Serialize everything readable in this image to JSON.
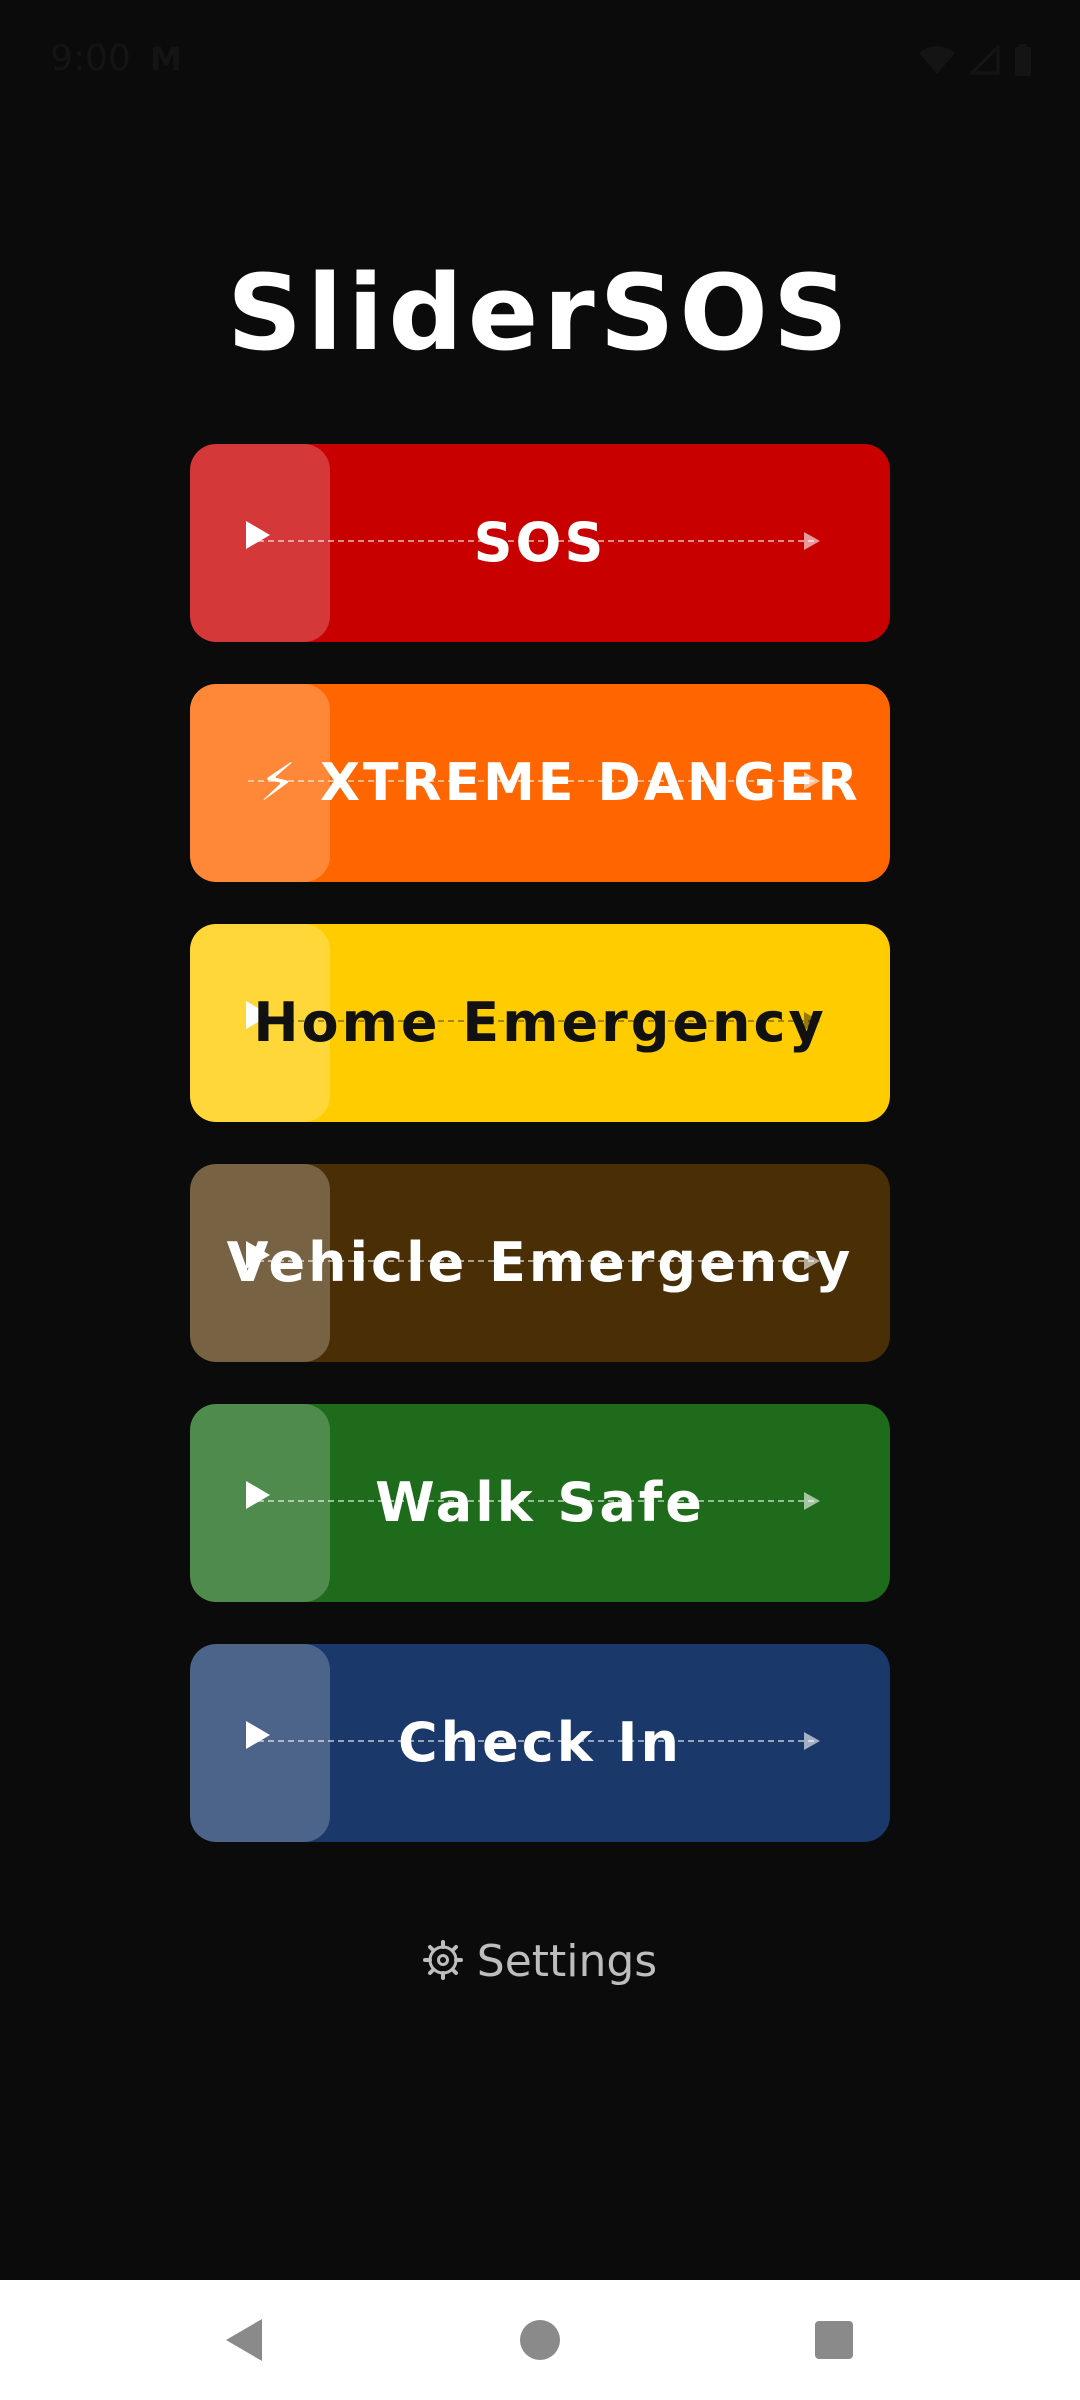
{
  "status_bar": {
    "time": "9:00",
    "app_indicator": "M"
  },
  "app": {
    "title": "SliderSOS"
  },
  "sliders": [
    {
      "label": "SOS",
      "color": "#c80000",
      "text_color": "#ffffff"
    },
    {
      "label": "⚡ XTREME DANGER",
      "color": "#ff6600",
      "text_color": "#ffffff"
    },
    {
      "label": "Home Emergency",
      "color": "#ffcc00",
      "text_color": "#111111"
    },
    {
      "label": "Vehicle Emergency",
      "color": "#4a2f06",
      "text_color": "#ffffff"
    },
    {
      "label": "Walk Safe",
      "color": "#1e6b1c",
      "text_color": "#ffffff"
    },
    {
      "label": "Check In",
      "color": "#1a3869",
      "text_color": "#ffffff"
    }
  ],
  "settings": {
    "label": "Settings",
    "icon": "gear-icon"
  },
  "navigation": {
    "back_icon": "back-triangle-icon",
    "home_icon": "home-circle-icon",
    "recents_icon": "recents-square-icon"
  }
}
